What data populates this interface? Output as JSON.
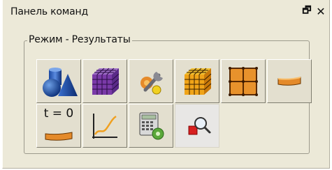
{
  "panel": {
    "title": "Панель команд",
    "controls": {
      "restore_icon": "restore-window-icon",
      "close_icon": "close-icon",
      "restore_glyph": "🗗",
      "close_glyph": "✕"
    }
  },
  "group": {
    "label": "Режим - Результаты",
    "buttons": [
      {
        "icon": "geometry-primitives-icon"
      },
      {
        "icon": "mesh-cube-purple-icon"
      },
      {
        "icon": "wrench-tools-icon"
      },
      {
        "icon": "mesh-cube-yellow-icon"
      },
      {
        "icon": "grid-plane-icon"
      },
      {
        "icon": "deformed-beam-icon"
      },
      {
        "icon": "time-step-icon",
        "text": "t = 0"
      },
      {
        "icon": "graph-curve-icon"
      },
      {
        "icon": "calculator-settings-icon"
      },
      {
        "icon": "zoom-inspect-icon",
        "selected": true
      }
    ]
  }
}
